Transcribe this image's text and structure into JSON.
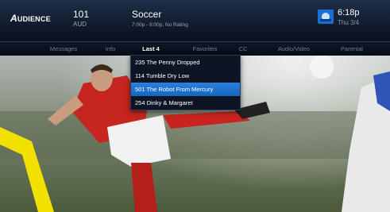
{
  "brand": {
    "name_lead": "A",
    "name_rest": "UDIENCE"
  },
  "channel": {
    "number": "101",
    "callsign": "AUD"
  },
  "program": {
    "title": "Soccer",
    "subtitle": "7:00p - 8:00p, No Rating"
  },
  "clock": {
    "time": "6:18p",
    "date": "Thu 3/4"
  },
  "tabs": [
    {
      "label": "Messages"
    },
    {
      "label": "Info"
    },
    {
      "label": "Last 4",
      "active": true
    },
    {
      "label": "Favorites"
    },
    {
      "label": "CC"
    },
    {
      "label": "Audio/Video"
    },
    {
      "label": "Parental"
    }
  ],
  "last4_menu": {
    "items": [
      {
        "label": "235 The Penny Dropped"
      },
      {
        "label": "114 Tumble Dry Low"
      },
      {
        "label": "501 The Robot From Mercury",
        "highlighted": true
      },
      {
        "label": "254 Dinky & Margaret"
      }
    ]
  },
  "colors": {
    "highlight": "#1f74d6",
    "bar": "#0f1828",
    "accent_yellow": "#f2e100"
  },
  "icons": {
    "provider_logo": "directv-logo-icon"
  }
}
